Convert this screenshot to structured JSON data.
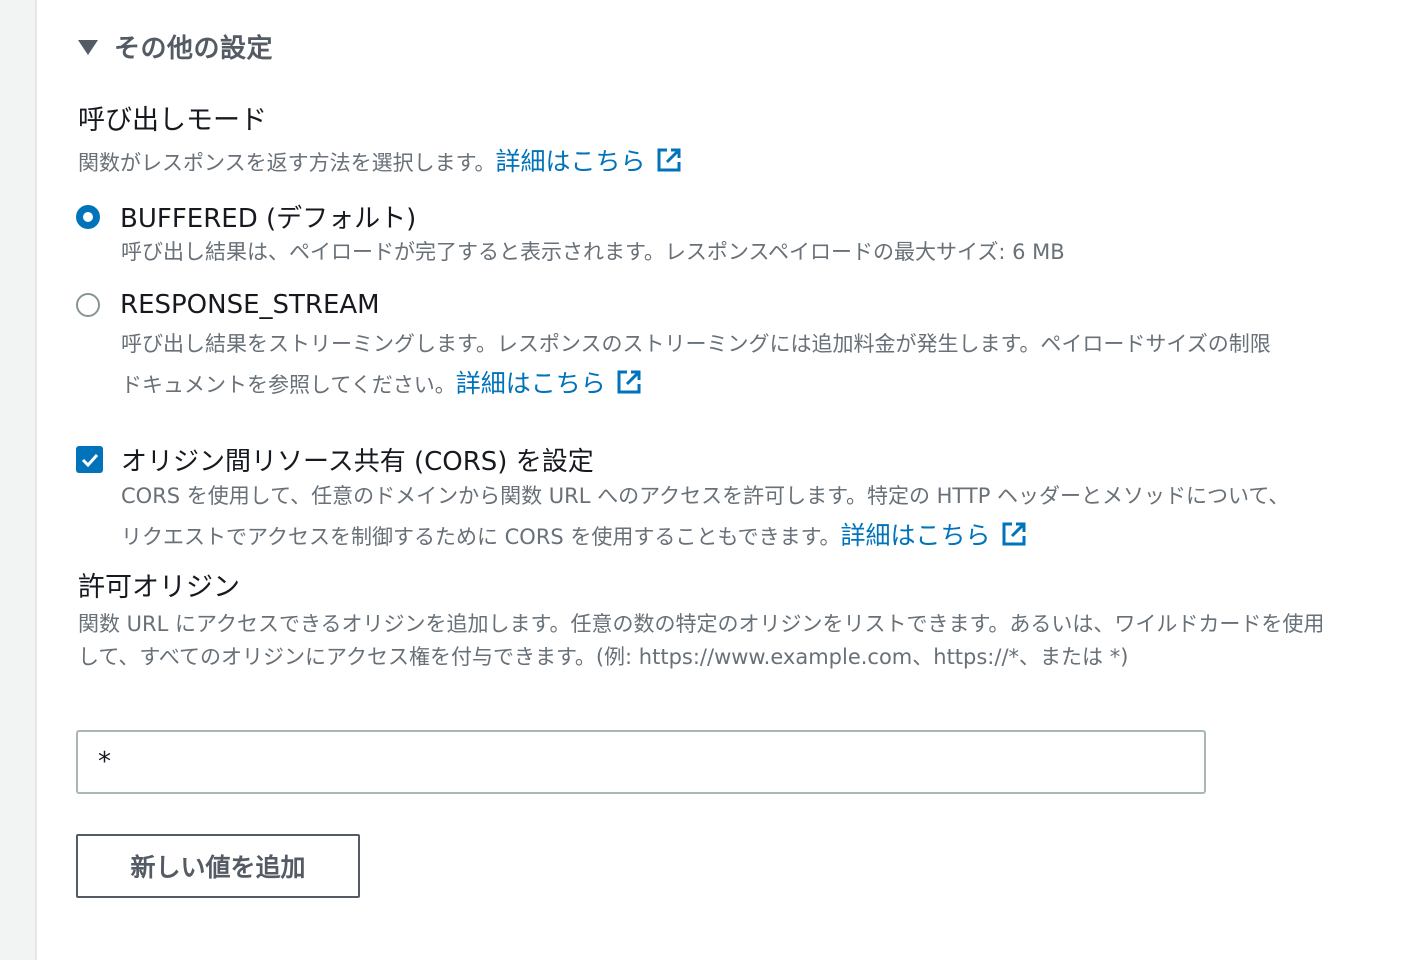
{
  "section": {
    "title": "その他の設定"
  },
  "invoke_mode": {
    "label": "呼び出しモード",
    "description": "関数がレスポンスを返す方法を選択します。",
    "learn_more": "詳細はこちら",
    "options": [
      {
        "label": "BUFFERED (デフォルト)",
        "description": "呼び出し結果は、ペイロードが完了すると表示されます。レスポンスペイロードの最大サイズ: 6 MB",
        "selected": true
      },
      {
        "label": "RESPONSE_STREAM",
        "description_line1": "呼び出し結果をストリーミングします。レスポンスのストリーミングには追加料金が発生します。ペイロードサイズの制限",
        "description_line2": "ドキュメントを参照してください。",
        "learn_more": "詳細はこちら",
        "selected": false
      }
    ]
  },
  "cors": {
    "label": "オリジン間リソース共有 (CORS) を設定",
    "checked": true,
    "description_line1": "CORS を使用して、任意のドメインから関数 URL へのアクセスを許可します。特定の HTTP ヘッダーとメソッドについて、",
    "description_line2": "リクエストでアクセスを制御するために CORS を使用することもできます。",
    "learn_more": "詳細はこちら"
  },
  "allowed_origins": {
    "label": "許可オリジン",
    "description_line1": "関数 URL にアクセスできるオリジンを追加します。任意の数の特定のオリジンをリストできます。あるいは、ワイルドカードを使用",
    "description_line2": "して、すべてのオリジンにアクセス権を付与できます。(例: https://www.example.com、https://*、または *)",
    "value": "*",
    "add_button": "新しい値を追加"
  },
  "colors": {
    "accent": "#0073bb",
    "text": "#16191f",
    "muted": "#687078",
    "header": "#545b64"
  },
  "icons": {
    "caret": "caret-down-icon",
    "external": "external-link-icon",
    "check": "checkmark-icon"
  }
}
